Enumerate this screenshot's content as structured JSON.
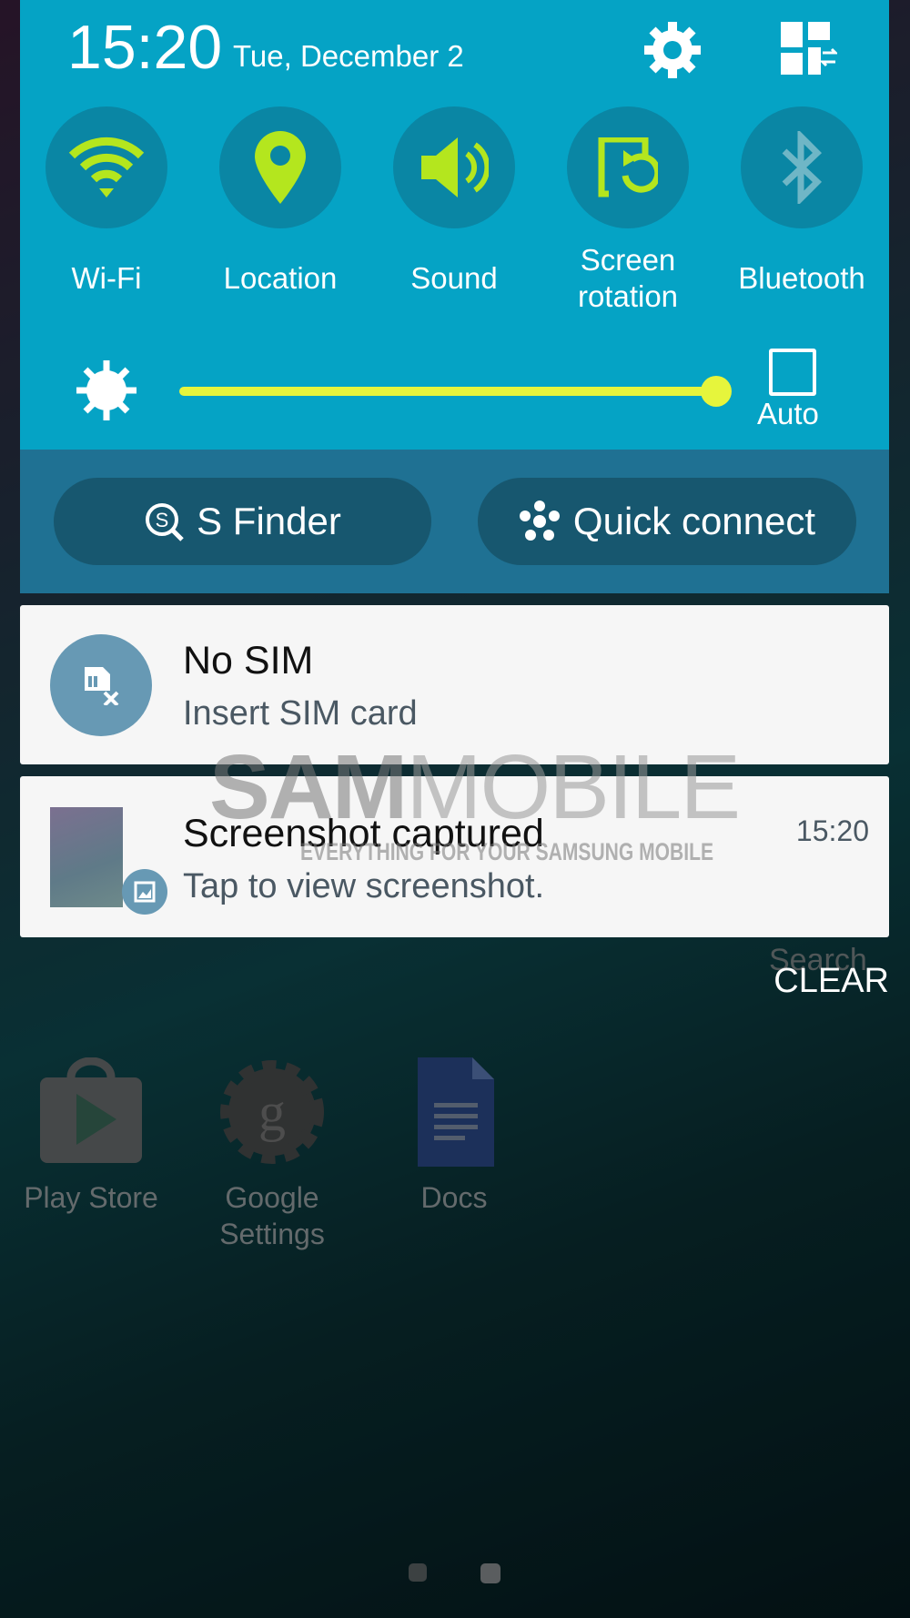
{
  "status": {
    "time": "15:20",
    "date": "Tue, December 2"
  },
  "header_icons": [
    {
      "icon": "gear-icon"
    },
    {
      "icon": "quick-panel-edit-icon"
    }
  ],
  "toggles": [
    {
      "label": "Wi-Fi",
      "icon": "wifi-icon",
      "active": true
    },
    {
      "label": "Location",
      "icon": "location-pin-icon",
      "active": true
    },
    {
      "label": "Sound",
      "icon": "speaker-icon",
      "active": true
    },
    {
      "label_line1": "Screen",
      "label_line2": "rotation",
      "icon": "screen-rotation-icon",
      "active": true
    },
    {
      "label": "Bluetooth",
      "icon": "bluetooth-icon",
      "active": false
    }
  ],
  "brightness": {
    "level_percent": 100,
    "auto_label": "Auto",
    "auto_checked": false
  },
  "buttons": {
    "s_finder": "S Finder",
    "quick_connect": "Quick connect"
  },
  "notifications": [
    {
      "title": "No SIM",
      "text": "Insert SIM card",
      "icon": "sim-card-x-icon"
    },
    {
      "title": "Screenshot captured",
      "text": "Tap to view screenshot.",
      "time": "15:20",
      "icon": "gallery-icon"
    }
  ],
  "clear_label": "CLEAR",
  "home_apps": [
    {
      "label": "Play Store"
    },
    {
      "label_line1": "Google",
      "label_line2": "Settings"
    },
    {
      "label": "Docs"
    }
  ],
  "background_partial": {
    "search_label": "Search"
  },
  "watermark": {
    "brand_bold": "SAM",
    "brand_light": "MOBILE",
    "tagline": "EVERYTHING FOR YOUR SAMSUNG MOBILE"
  },
  "colors": {
    "panel": "#05a3c5",
    "toggle_active": "#b4e61e",
    "toggle_inactive": "#6fb6c6",
    "slider": "#e6f53c"
  }
}
